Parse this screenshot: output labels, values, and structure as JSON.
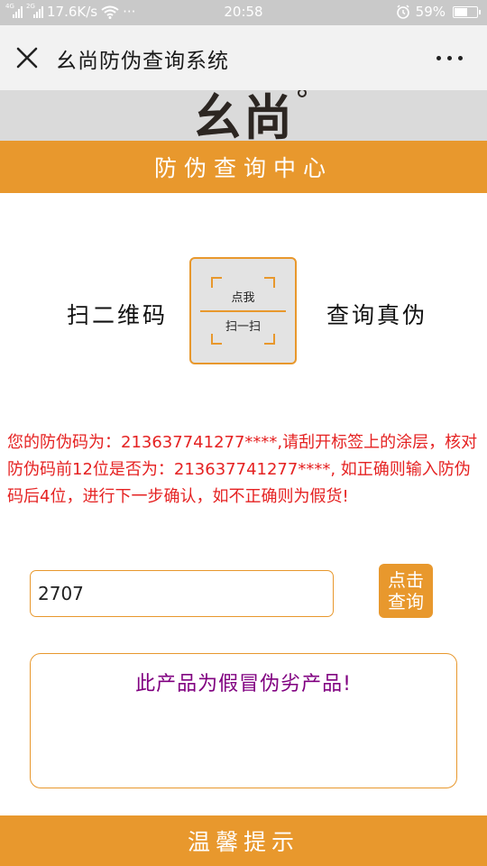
{
  "status_bar": {
    "net_4g": "4G",
    "net_2g": "2G",
    "speed": "17.6K/s",
    "more": "···",
    "time": "20:58",
    "battery": "59%",
    "battery_level": 0.59
  },
  "nav": {
    "title": "幺尚防伪查询系统"
  },
  "logo": {
    "text": "幺尚"
  },
  "banner": {
    "title": "防伪查询中心"
  },
  "scan": {
    "left_label": "扫二维码",
    "right_label": "查询真伪",
    "button_top": "点我",
    "button_bottom": "扫一扫"
  },
  "notice": {
    "text": "您的防伪码为：213637741277****,请刮开标签上的涂层，核对防伪码前12位是否为：213637741277****, 如正确则输入防伪码后4位，进行下一步确认，如不正确则为假货!"
  },
  "query": {
    "input_value": "2707",
    "button_line1": "点击",
    "button_line2": "查询"
  },
  "result": {
    "text": "此产品为假冒伪劣产品!"
  },
  "footer": {
    "title": "温馨提示"
  },
  "colors": {
    "accent": "#e8982d",
    "notice": "#e52222",
    "result": "#800080"
  }
}
